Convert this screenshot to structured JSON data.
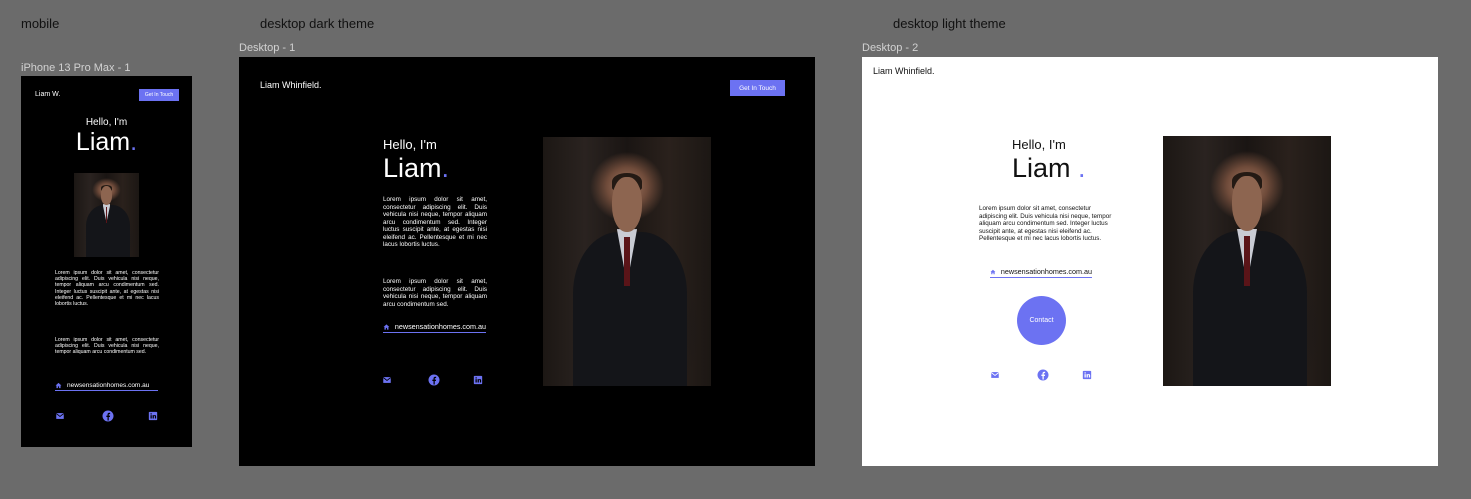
{
  "canvas": {
    "label_mobile": "mobile",
    "label_dark": "desktop dark theme",
    "label_light": "desktop light theme"
  },
  "mobile": {
    "frame_name": "iPhone 13 Pro Max - 1",
    "brand": "Liam W.",
    "cta": "Get In Touch",
    "hello": "Hello, I'm",
    "name": "Liam",
    "dot": ".",
    "para1": "Lorem ipsum dolor sit amet, consectetur adipiscing elit. Duis vehicula nisi neque, tempor aliquam arcu condimentum sed. Integer luctus suscipit ante, at egestas nisi eleifend ac. Pellentesque et mi nec lacus lobortis luctus.",
    "para2": "Lorem ipsum dolor sit amet, consectetur adipiscing elit. Duis vehicula nisi neque, tempor aliquam arcu condimentum sed.",
    "link": "newsensationhomes.com.au"
  },
  "dark": {
    "frame_name": "Desktop - 1",
    "brand": "Liam Whinfield.",
    "cta": "Get In Touch",
    "hello": "Hello, I'm",
    "name": "Liam",
    "dot": ".",
    "para1": "Lorem ipsum dolor sit amet, consectetur adipiscing elit. Duis vehicula nisi neque, tempor aliquam arcu condimentum sed. Integer luctus suscipit ante, at egestas nisi eleifend ac. Pellentesque et mi nec lacus lobortis luctus.",
    "para2": "Lorem ipsum dolor sit amet, consectetur adipiscing elit. Duis vehicula nisi neque, tempor aliquam arcu condimentum sed.",
    "link": "newsensationhomes.com.au"
  },
  "light": {
    "frame_name": "Desktop - 2",
    "brand": "Liam Whinfield.",
    "hello": "Hello, I'm",
    "name": "Liam",
    "dot": ".",
    "para1": "Lorem ipsum dolor sit amet, consectetur adipiscing elit. Duis vehicula nisi neque, tempor aliquam arcu condimentum sed. Integer luctus suscipit ante, at egestas nisi eleifend ac. Pellentesque et mi nec lacus lobortis luctus.",
    "link": "newsensationhomes.com.au",
    "contact": "Contact"
  },
  "icons": {
    "mail": "mail-icon",
    "facebook": "facebook-icon",
    "linkedin": "linkedin-icon",
    "home": "home-icon"
  },
  "colors": {
    "accent": "#6c72f2",
    "canvas_bg": "#6b6b6b",
    "dark_bg": "#000000",
    "light_bg": "#ffffff"
  }
}
